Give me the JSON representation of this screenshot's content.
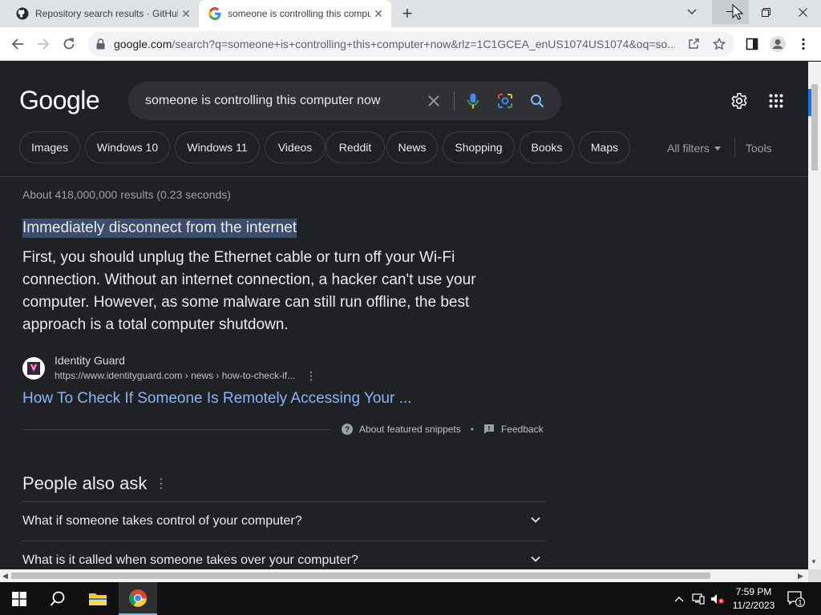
{
  "browser": {
    "tabs": [
      {
        "title": "Repository search results · GitHub",
        "favicon": "github-icon"
      },
      {
        "title": "someone is controlling this computer now - Google Search",
        "favicon": "google-icon"
      }
    ],
    "url_host": "google.com",
    "url_rest": "/search?q=someone+is+controlling+this+computer+now&rlz=1C1GCEA_enUS1074US1074&oq=so..."
  },
  "search": {
    "logo": "Google",
    "query": "someone is controlling this computer now",
    "chips": [
      "Images",
      "Windows 10",
      "Windows 11",
      "Videos",
      "Reddit",
      "News",
      "Shopping",
      "Books",
      "Maps"
    ],
    "all_filters": "All filters",
    "tools": "Tools"
  },
  "results": {
    "stats": "About 418,000,000 results (0.23 seconds)",
    "featured": {
      "title": "Immediately disconnect from the internet",
      "body": "First, you should unplug the Ethernet cable or turn off your Wi-Fi connection. Without an internet connection, a hacker can't use your computer. However, as some malware can still run offline, the best approach is a total computer shutdown.",
      "source_name": "Identity Guard",
      "source_url": "https://www.identityguard.com › news › how-to-check-if...",
      "link_text": "How To Check If Someone Is Remotely Accessing Your ...",
      "about": "About featured snippets",
      "feedback": "Feedback"
    },
    "people_also_ask": {
      "title": "People also ask",
      "questions": [
        "What if someone takes control of your computer?",
        "What is it called when someone takes over your computer?"
      ]
    }
  },
  "taskbar": {
    "time": "7:59 PM",
    "date": "11/2/2023",
    "notification_count": "1"
  }
}
